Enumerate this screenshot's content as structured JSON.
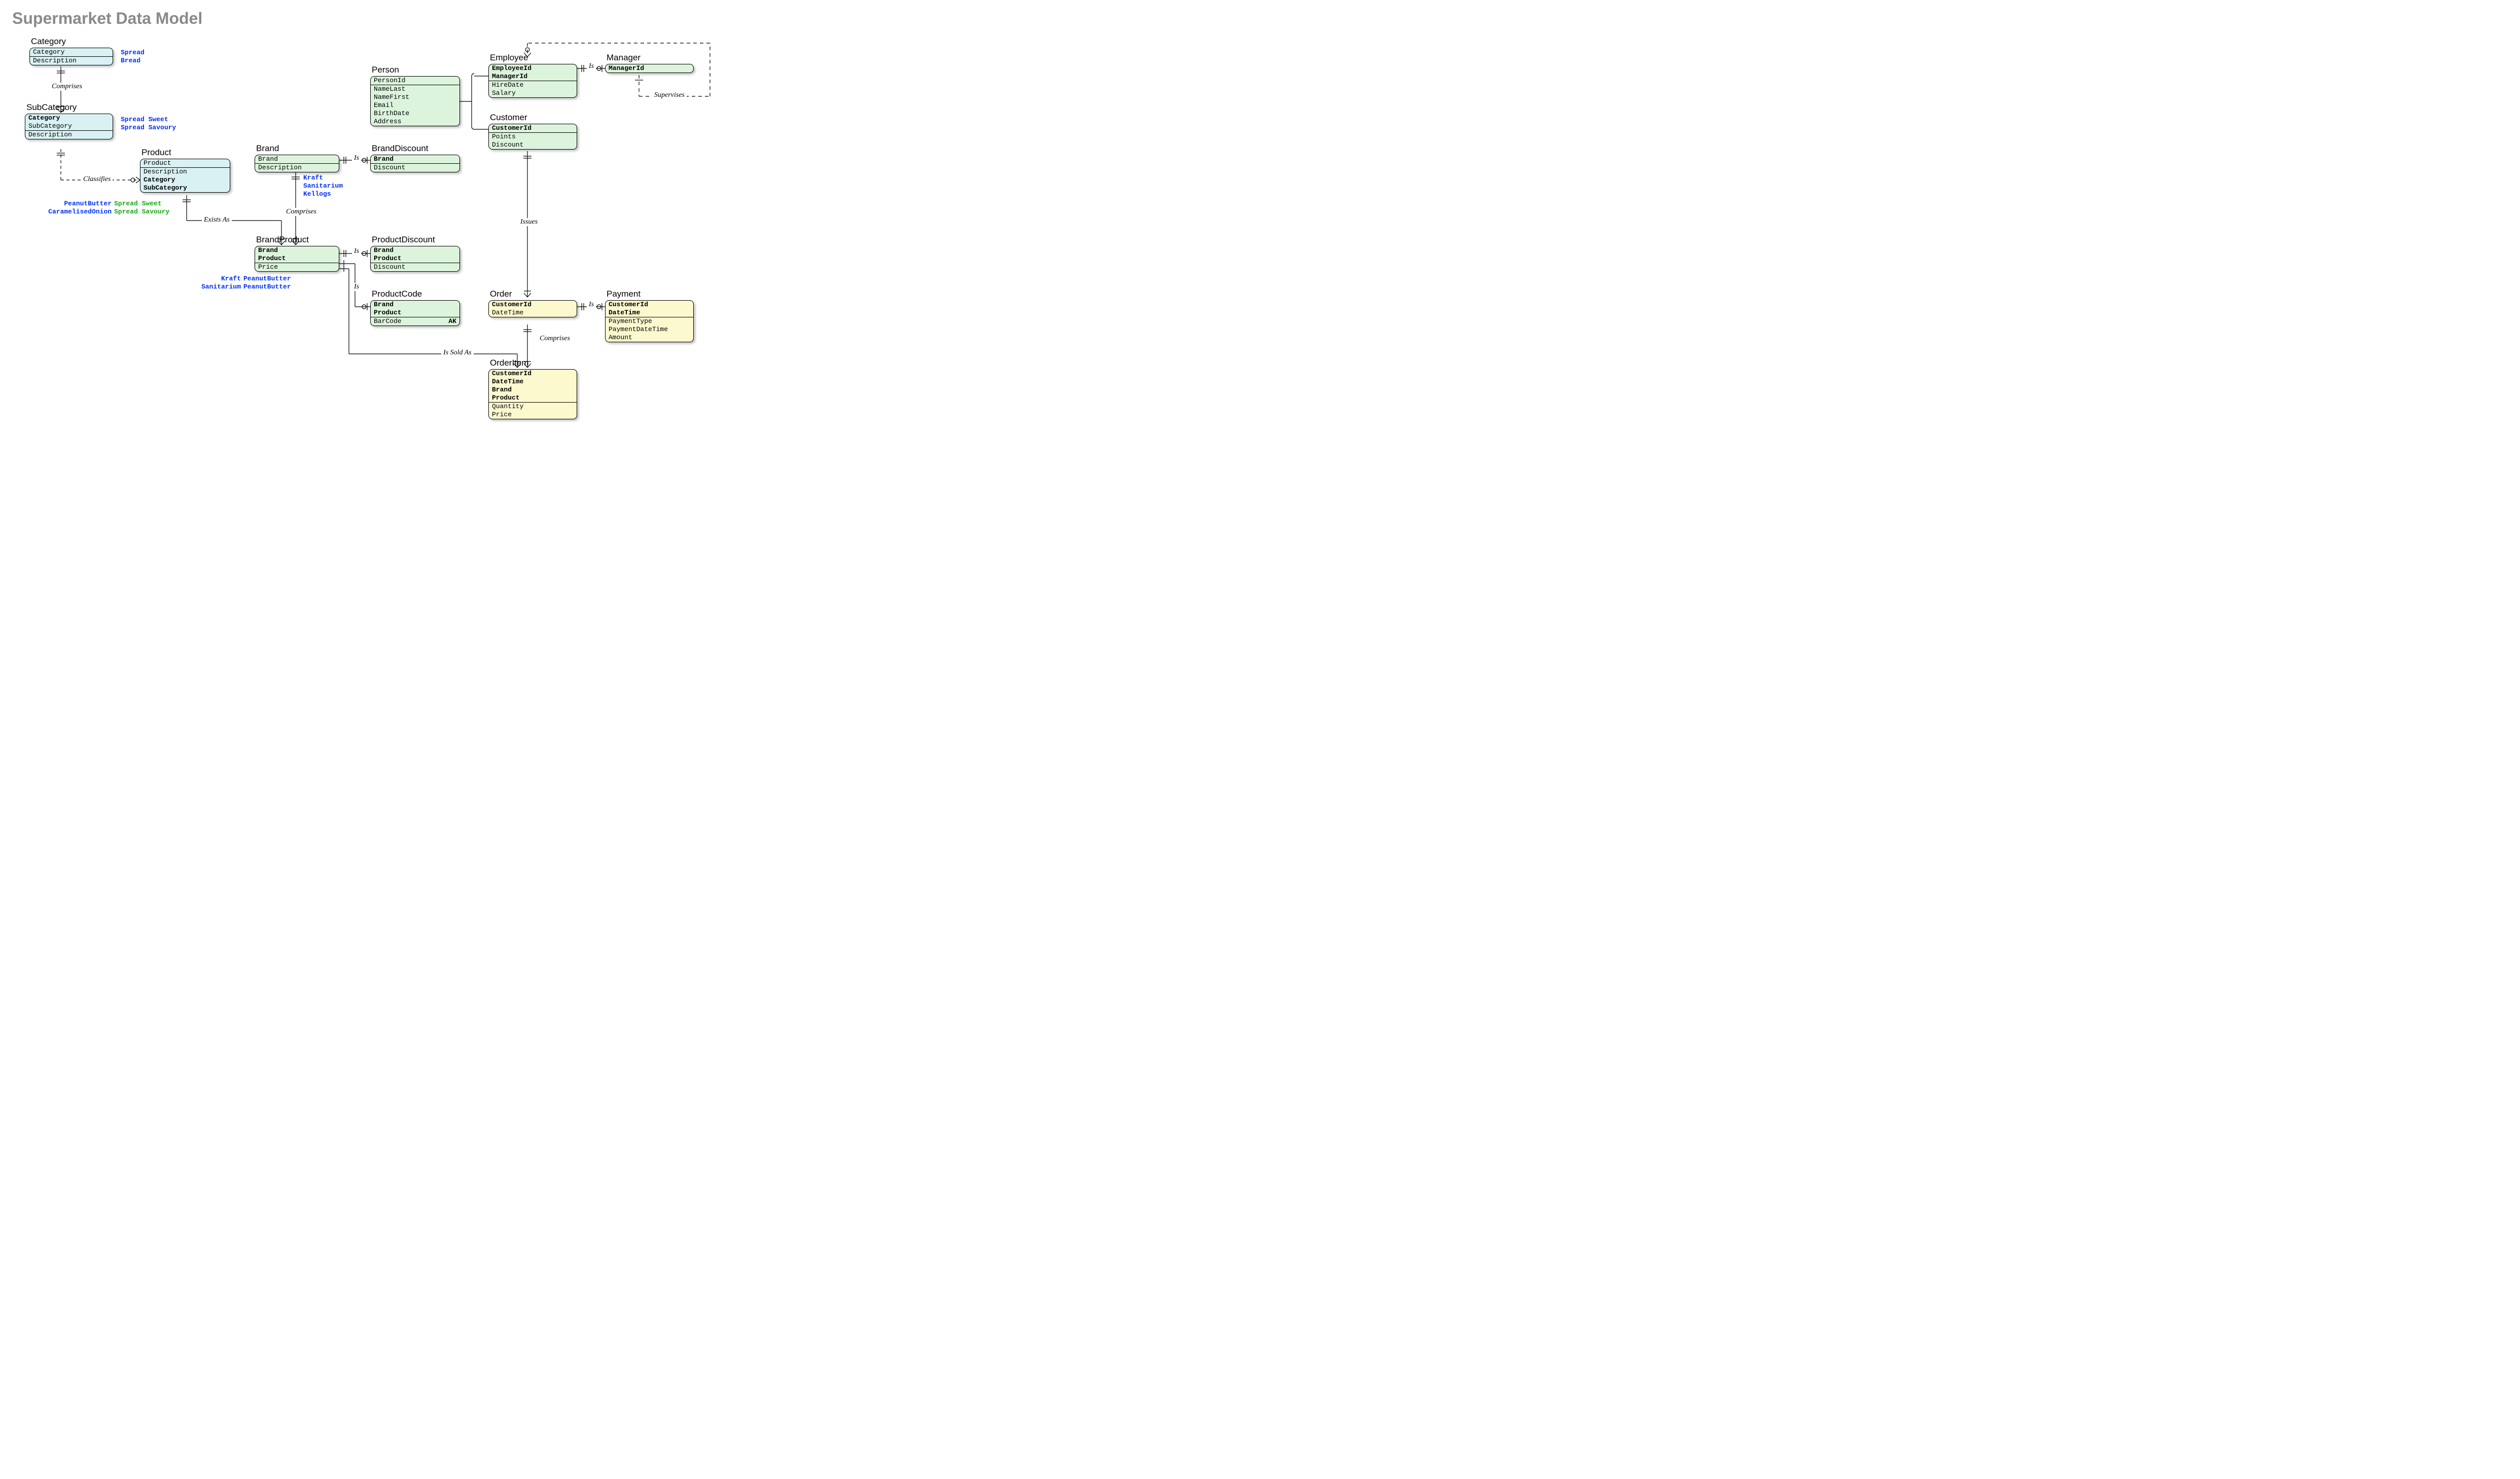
{
  "title": "Supermarket Data Model",
  "entities": {
    "Category": {
      "caption": "Category",
      "rows": [
        [
          "Category",
          "n"
        ],
        [
          "Description",
          "n"
        ]
      ],
      "divAfter": [
        0
      ]
    },
    "SubCategory": {
      "caption": "SubCategory",
      "rows": [
        [
          "Category",
          "b"
        ],
        [
          "SubCategory",
          "n"
        ],
        [
          "Description",
          "n"
        ]
      ],
      "divAfter": [
        1
      ]
    },
    "Product": {
      "caption": "Product",
      "rows": [
        [
          "Product",
          "n"
        ],
        [
          "Description",
          "n"
        ],
        [
          "Category",
          "b"
        ],
        [
          "SubCategory",
          "b"
        ]
      ],
      "divAfter": [
        0
      ]
    },
    "Brand": {
      "caption": "Brand",
      "rows": [
        [
          "Brand",
          "n"
        ],
        [
          "Description",
          "n"
        ]
      ],
      "divAfter": [
        0
      ]
    },
    "BrandProduct": {
      "caption": "BrandProduct",
      "rows": [
        [
          "Brand",
          "b"
        ],
        [
          "Product",
          "b"
        ],
        [
          "Price",
          "n"
        ]
      ],
      "divAfter": [
        1
      ]
    },
    "BrandDiscount": {
      "caption": "BrandDiscount",
      "rows": [
        [
          "Brand",
          "b"
        ],
        [
          "Discount",
          "n"
        ]
      ],
      "divAfter": [
        0
      ]
    },
    "ProductDiscount": {
      "caption": "ProductDiscount",
      "rows": [
        [
          "Brand",
          "b"
        ],
        [
          "Product",
          "b"
        ],
        [
          "Discount",
          "n"
        ]
      ],
      "divAfter": [
        1
      ]
    },
    "ProductCode": {
      "caption": "ProductCode",
      "rows": [
        [
          "Brand",
          "b"
        ],
        [
          "Product",
          "b"
        ],
        [
          "BarCode",
          "n"
        ]
      ],
      "divAfter": [
        1
      ],
      "ak": "AK"
    },
    "Person": {
      "caption": "Person",
      "rows": [
        [
          "PersonId",
          "n"
        ],
        [
          "NameLast",
          "n"
        ],
        [
          "NameFirst",
          "n"
        ],
        [
          "Email",
          "n"
        ],
        [
          "BirthDate",
          "n"
        ],
        [
          "Address",
          "n"
        ]
      ],
      "divAfter": [
        0
      ]
    },
    "Employee": {
      "caption": "Employee",
      "rows": [
        [
          "EmployeeId",
          "b"
        ],
        [
          "ManagerId",
          "b"
        ],
        [
          "HireDate",
          "n"
        ],
        [
          "Salary",
          "n"
        ]
      ],
      "divAfter": [
        1
      ]
    },
    "Manager": {
      "caption": "Manager",
      "rows": [
        [
          "ManagerId",
          "b"
        ]
      ],
      "divAfter": []
    },
    "Customer": {
      "caption": "Customer",
      "rows": [
        [
          "CustomerId",
          "b"
        ],
        [
          "Points",
          "n"
        ],
        [
          "Discount",
          "n"
        ]
      ],
      "divAfter": [
        0
      ]
    },
    "Order": {
      "caption": "Order",
      "rows": [
        [
          "CustomerId",
          "b"
        ],
        [
          "DateTime",
          "n"
        ]
      ],
      "divAfter": [
        1
      ]
    },
    "Payment": {
      "caption": "Payment",
      "rows": [
        [
          "CustomerId",
          "b"
        ],
        [
          "DateTime",
          "b"
        ],
        [
          "PaymentType",
          "n"
        ],
        [
          "PaymentDateTime",
          "n"
        ],
        [
          "Amount",
          "n"
        ]
      ],
      "divAfter": [
        1
      ]
    },
    "OrderItem": {
      "caption": "OrderItem",
      "rows": [
        [
          "CustomerId",
          "b"
        ],
        [
          "DateTime",
          "b"
        ],
        [
          "Brand",
          "b"
        ],
        [
          "Product",
          "b"
        ],
        [
          "Quantity",
          "n"
        ],
        [
          "Price",
          "n"
        ]
      ],
      "divAfter": [
        3
      ]
    }
  },
  "notes": {
    "n1": {
      "lines": [
        "Spread",
        "Bread"
      ]
    },
    "n2": {
      "lines": [
        "Spread Sweet",
        "Spread Savoury"
      ]
    },
    "n3a": {
      "lines": [
        "PeanutButter",
        "CaramelisedOnion"
      ]
    },
    "n3b": {
      "lines": [
        "Spread Sweet",
        "Spread Savoury"
      ]
    },
    "n4": {
      "lines": [
        "Kraft",
        "Sanitarium",
        "Kellogs"
      ]
    },
    "n5a": {
      "lines": [
        "Kraft",
        "Sanitarium"
      ]
    },
    "n5b": {
      "lines": [
        "PeanutButter",
        "PeanutButter"
      ]
    }
  },
  "relLabels": {
    "comprises1": "Comprises",
    "classifies": "Classifies",
    "existsAs": "Exists As",
    "comprises2": "Comprises",
    "isBD": "Is",
    "isPD": "Is",
    "isPC": "Is",
    "soldAs": "Is Sold As",
    "issues": "Issues",
    "comprises3": "Comprises",
    "isPay": "Is",
    "isEmp": "Is",
    "supervises": "Supervises"
  }
}
